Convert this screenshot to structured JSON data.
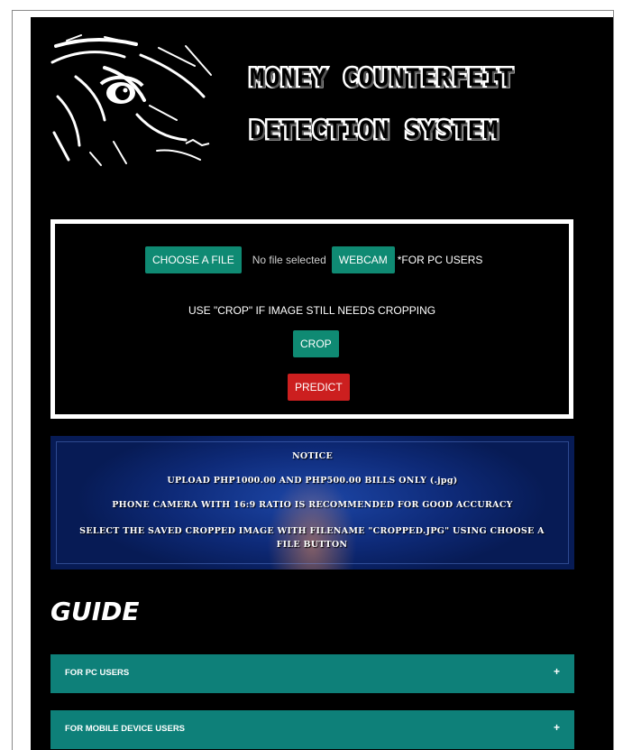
{
  "header": {
    "title_line1": "MONEY COUNTERFEIT",
    "title_line2": "DETECTION SYSTEM",
    "logo_icon": "eagle-eye-logo"
  },
  "upload": {
    "choose_file_label": "CHOOSE A FILE",
    "file_status": "No file selected",
    "webcam_label": "WEBCAM",
    "webcam_note": "*FOR PC USERS",
    "crop_hint": "USE \"CROP\" IF IMAGE STILL NEEDS CROPPING",
    "crop_label": "CROP",
    "predict_label": "PREDICT"
  },
  "notice": {
    "heading": "NOTICE",
    "line1": "UPLOAD PHP1000.00 AND PHP500.00 BILLS ONLY (.jpg)",
    "line2": "PHONE CAMERA WITH 16:9 RATIO IS RECOMMENDED FOR GOOD ACCURACY",
    "line3": "SELECT THE SAVED CROPPED IMAGE WITH FILENAME \"CROPPED.JPG\" USING CHOOSE A FILE BUTTON"
  },
  "guide": {
    "title": "GUIDE",
    "items": [
      {
        "label": "FOR PC USERS",
        "toggle": "+"
      },
      {
        "label": "FOR MOBILE DEVICE USERS",
        "toggle": "+"
      }
    ]
  },
  "colors": {
    "background": "#000000",
    "button_teal": "#0f8a73",
    "button_red": "#cc1f1f",
    "accordion_teal": "#0e8079",
    "notice_blue": "#1d47a8"
  }
}
